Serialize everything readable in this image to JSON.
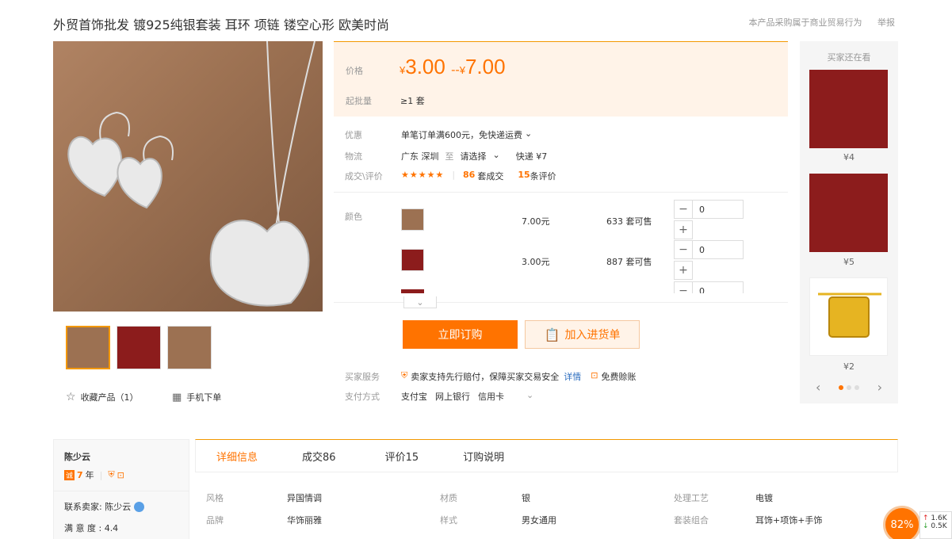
{
  "title": "外贸首饰批发 镀925纯银套装 耳环 项链 镂空心形 欧美时尚",
  "top_right": {
    "notice": "本产品采购属于商业贸易行为",
    "report": "举报"
  },
  "gallery": {
    "fav": "收藏产品（1）",
    "mobile": "手机下单"
  },
  "price": {
    "label": "价格",
    "yen": "¥",
    "low": "3.00",
    "sep": "--",
    "high": "7.00",
    "moq_label": "起批量",
    "moq": "≥1 套"
  },
  "info": {
    "promo_label": "优惠",
    "promo": "单笔订单满600元，免快递运费",
    "ship_label": "物流",
    "ship_from": "广东 深圳",
    "ship_to": "至",
    "ship_select": "请选择",
    "ship_fee": "快递 ¥7",
    "deal_label": "成交\\评价",
    "stars": "★★★★★",
    "deals_num": "86",
    "deals_unit": "套成交",
    "reviews_num": "15",
    "reviews_unit": "条评价"
  },
  "sku": {
    "label": "颜色",
    "rows": [
      {
        "price": "7.00元",
        "stock": "633 套可售",
        "qty": "0"
      },
      {
        "price": "3.00元",
        "stock": "887 套可售",
        "qty": "0"
      },
      {
        "qty": "0"
      }
    ]
  },
  "actions": {
    "order": "立即订购",
    "cart": "加入进货单"
  },
  "service": {
    "label": "买家服务",
    "text": "卖家支持先行赔付，保障买家交易安全",
    "detail": "详情",
    "free": "免费赊账"
  },
  "pay": {
    "label": "支付方式",
    "m1": "支付宝",
    "m2": "网上银行",
    "m3": "信用卡"
  },
  "side": {
    "title": "买家还在看",
    "prices": [
      "¥4",
      "¥5",
      "¥2"
    ]
  },
  "seller": {
    "name": "陈少云",
    "years": "7",
    "year_unit": "年",
    "contact": "联系卖家: 陈少云",
    "satisfaction": "满 意 度 : 4.4"
  },
  "tabs": [
    "详细信息",
    "成交86",
    "评价15",
    "订购说明"
  ],
  "attrs": [
    {
      "k": "风格",
      "v": "异国情调"
    },
    {
      "k": "材质",
      "v": "银"
    },
    {
      "k": "处理工艺",
      "v": "电镀"
    },
    {
      "k": "品牌",
      "v": "华饰丽雅"
    },
    {
      "k": "样式",
      "v": "男女通用"
    },
    {
      "k": "套装组合",
      "v": "耳饰+项饰+手饰"
    }
  ],
  "widget": {
    "percent": "82%",
    "up": "1.6K",
    "down": "0.5K"
  },
  "colors": {
    "accent": "#ff7300",
    "accent_bg": "#fff3e8"
  }
}
